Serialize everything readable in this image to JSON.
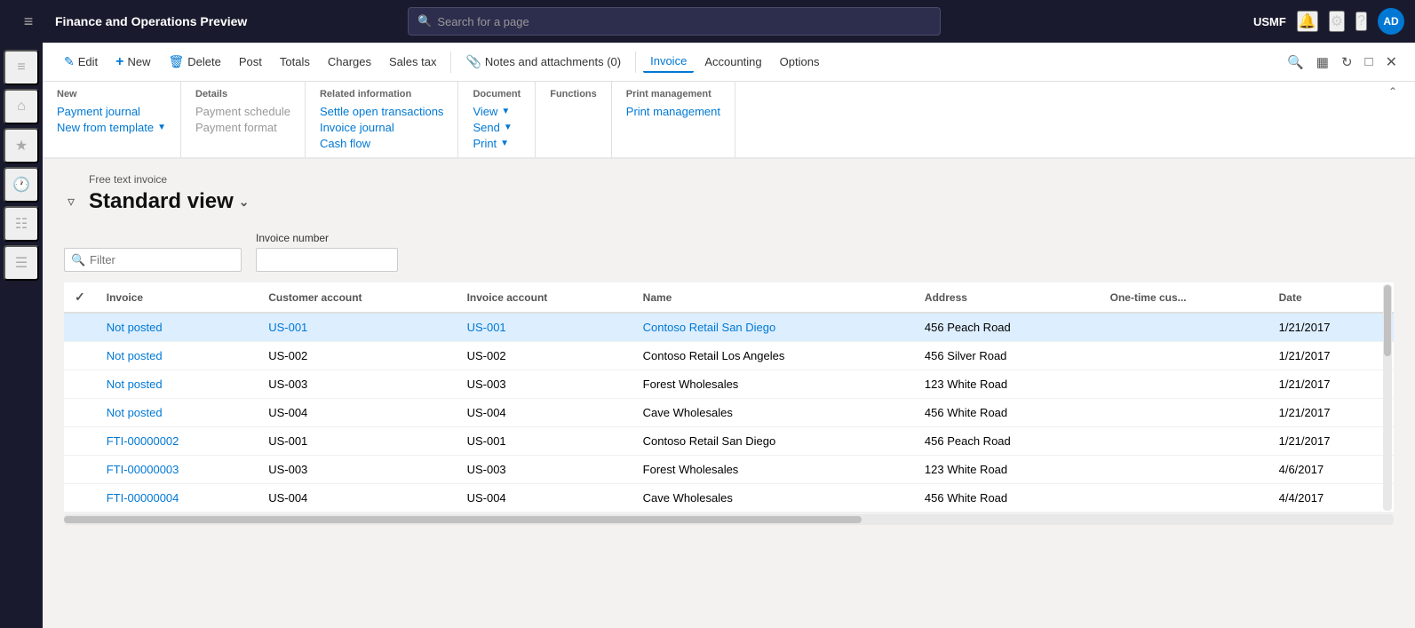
{
  "app": {
    "title": "Finance and Operations Preview",
    "org": "USMF",
    "avatar": "AD"
  },
  "search": {
    "placeholder": "Search for a page"
  },
  "actionBar": {
    "buttons": [
      {
        "id": "edit",
        "label": "Edit",
        "icon": "✏️"
      },
      {
        "id": "new",
        "label": "New",
        "icon": "+"
      },
      {
        "id": "delete",
        "label": "Delete",
        "icon": "🗑"
      },
      {
        "id": "post",
        "label": "Post",
        "icon": ""
      },
      {
        "id": "totals",
        "label": "Totals",
        "icon": ""
      },
      {
        "id": "charges",
        "label": "Charges",
        "icon": ""
      },
      {
        "id": "sales-tax",
        "label": "Sales tax",
        "icon": ""
      },
      {
        "id": "notes",
        "label": "Notes and attachments (0)",
        "icon": "📎"
      },
      {
        "id": "invoice",
        "label": "Invoice",
        "icon": ""
      },
      {
        "id": "accounting",
        "label": "Accounting",
        "icon": ""
      },
      {
        "id": "options",
        "label": "Options",
        "icon": ""
      }
    ]
  },
  "menuBar": {
    "sections": [
      {
        "title": "New",
        "items": [
          {
            "id": "payment-journal",
            "label": "Payment journal",
            "disabled": false,
            "hasChevron": false
          },
          {
            "id": "new-from-template",
            "label": "New from template",
            "disabled": false,
            "hasChevron": true
          }
        ]
      },
      {
        "title": "Details",
        "items": [
          {
            "id": "payment-schedule",
            "label": "Payment schedule",
            "disabled": true,
            "hasChevron": false
          },
          {
            "id": "payment-format",
            "label": "Payment format",
            "disabled": true,
            "hasChevron": false
          }
        ]
      },
      {
        "title": "Related information",
        "items": [
          {
            "id": "settle-open",
            "label": "Settle open transactions",
            "disabled": false,
            "hasChevron": false
          },
          {
            "id": "invoice-journal",
            "label": "Invoice journal",
            "disabled": false,
            "hasChevron": false
          },
          {
            "id": "cash-flow",
            "label": "Cash flow",
            "disabled": false,
            "hasChevron": false
          }
        ]
      },
      {
        "title": "Document",
        "items": [
          {
            "id": "view",
            "label": "View",
            "disabled": false,
            "hasChevron": true
          },
          {
            "id": "send",
            "label": "Send",
            "disabled": false,
            "hasChevron": true
          },
          {
            "id": "print",
            "label": "Print",
            "disabled": false,
            "hasChevron": true
          }
        ]
      },
      {
        "title": "Functions",
        "items": []
      },
      {
        "title": "Print management",
        "items": [
          {
            "id": "print-management",
            "label": "Print management",
            "disabled": false,
            "hasChevron": false
          }
        ]
      }
    ]
  },
  "page": {
    "breadcrumb": "Free text invoice",
    "viewTitle": "Standard view",
    "filterPlaceholder": "Filter",
    "invoiceNumberLabel": "Invoice number"
  },
  "table": {
    "columns": [
      {
        "id": "check",
        "label": ""
      },
      {
        "id": "invoice",
        "label": "Invoice"
      },
      {
        "id": "customer-account",
        "label": "Customer account"
      },
      {
        "id": "invoice-account",
        "label": "Invoice account"
      },
      {
        "id": "name",
        "label": "Name"
      },
      {
        "id": "address",
        "label": "Address"
      },
      {
        "id": "one-time-cus",
        "label": "One-time cus..."
      },
      {
        "id": "date",
        "label": "Date"
      }
    ],
    "rows": [
      {
        "invoice": "Not posted",
        "customerAccount": "US-001",
        "invoiceAccount": "US-001",
        "name": "Contoso Retail San Diego",
        "address": "456 Peach Road",
        "oneTimeCus": "",
        "date": "1/21/2017",
        "isLink": true,
        "selected": true
      },
      {
        "invoice": "Not posted",
        "customerAccount": "US-002",
        "invoiceAccount": "US-002",
        "name": "Contoso Retail Los Angeles",
        "address": "456 Silver Road",
        "oneTimeCus": "",
        "date": "1/21/2017",
        "isLink": true,
        "selected": false
      },
      {
        "invoice": "Not posted",
        "customerAccount": "US-003",
        "invoiceAccount": "US-003",
        "name": "Forest Wholesales",
        "address": "123 White Road",
        "oneTimeCus": "",
        "date": "1/21/2017",
        "isLink": true,
        "selected": false
      },
      {
        "invoice": "Not posted",
        "customerAccount": "US-004",
        "invoiceAccount": "US-004",
        "name": "Cave Wholesales",
        "address": "456 White Road",
        "oneTimeCus": "",
        "date": "1/21/2017",
        "isLink": true,
        "selected": false
      },
      {
        "invoice": "FTI-00000002",
        "customerAccount": "US-001",
        "invoiceAccount": "US-001",
        "name": "Contoso Retail San Diego",
        "address": "456 Peach Road",
        "oneTimeCus": "",
        "date": "1/21/2017",
        "isLink": true,
        "selected": false
      },
      {
        "invoice": "FTI-00000003",
        "customerAccount": "US-003",
        "invoiceAccount": "US-003",
        "name": "Forest Wholesales",
        "address": "123 White Road",
        "oneTimeCus": "",
        "date": "4/6/2017",
        "isLink": true,
        "selected": false
      },
      {
        "invoice": "FTI-00000004",
        "customerAccount": "US-004",
        "invoiceAccount": "US-004",
        "name": "Cave Wholesales",
        "address": "456 White Road",
        "oneTimeCus": "",
        "date": "4/4/2017",
        "isLink": true,
        "selected": false
      }
    ]
  },
  "sidebar": {
    "icons": [
      {
        "id": "menu",
        "symbol": "☰"
      },
      {
        "id": "home",
        "symbol": "⌂"
      },
      {
        "id": "star",
        "symbol": "★"
      },
      {
        "id": "recent",
        "symbol": "🕐"
      },
      {
        "id": "workspace",
        "symbol": "⊞"
      },
      {
        "id": "list",
        "symbol": "≡"
      }
    ]
  }
}
